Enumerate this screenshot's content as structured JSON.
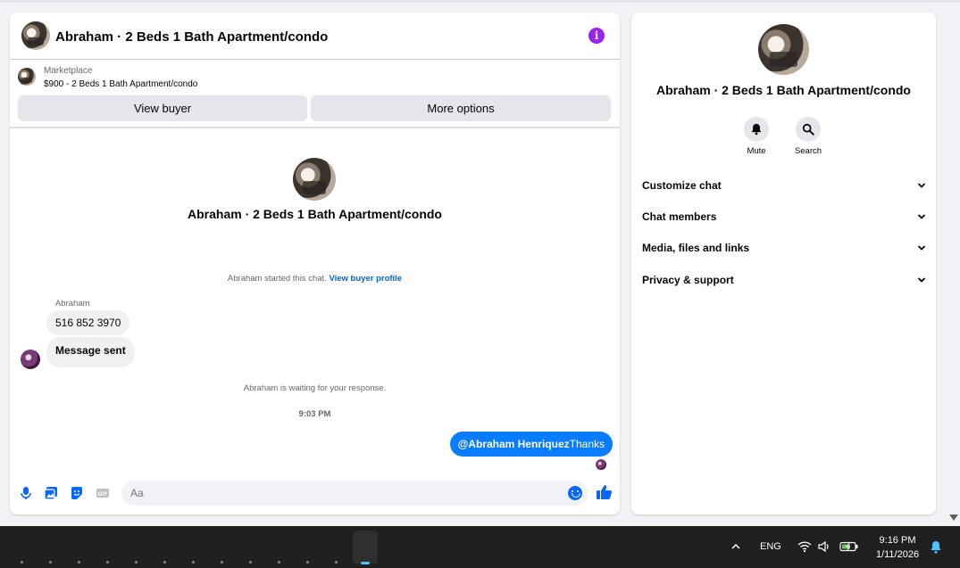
{
  "chat": {
    "header_title": "Abraham · 2 Beds 1 Bath Apartment/condo",
    "marketplace_label": "Marketplace",
    "listing": "$900 - 2 Beds 1 Bath Apartment/condo",
    "view_buyer": "View buyer",
    "more_options": "More options",
    "center_title": "Abraham · 2 Beds 1 Bath Apartment/condo",
    "started_text": "Abraham started this chat.",
    "view_profile": "View buyer profile",
    "sender_name": "Abraham",
    "messages_in": [
      "516 852 3970",
      "Message sent"
    ],
    "waiting_text": "Abraham is waiting for your response.",
    "time": "9:03 PM",
    "out_mention": "@Abraham Henriquez",
    "out_text": "Thanks",
    "composer_placeholder": "Aa"
  },
  "side": {
    "title": "Abraham · 2 Beds 1 Bath Apartment/condo",
    "mute": "Mute",
    "search": "Search",
    "rows": [
      "Customize chat",
      "Chat members",
      "Media, files and links",
      "Privacy & support"
    ]
  },
  "taskbar": {
    "lang": "ENG",
    "time": "9:16 PM",
    "date": "1/11/2026"
  },
  "colors": {
    "accent": "#0a7cff",
    "info": "#a020f0"
  }
}
